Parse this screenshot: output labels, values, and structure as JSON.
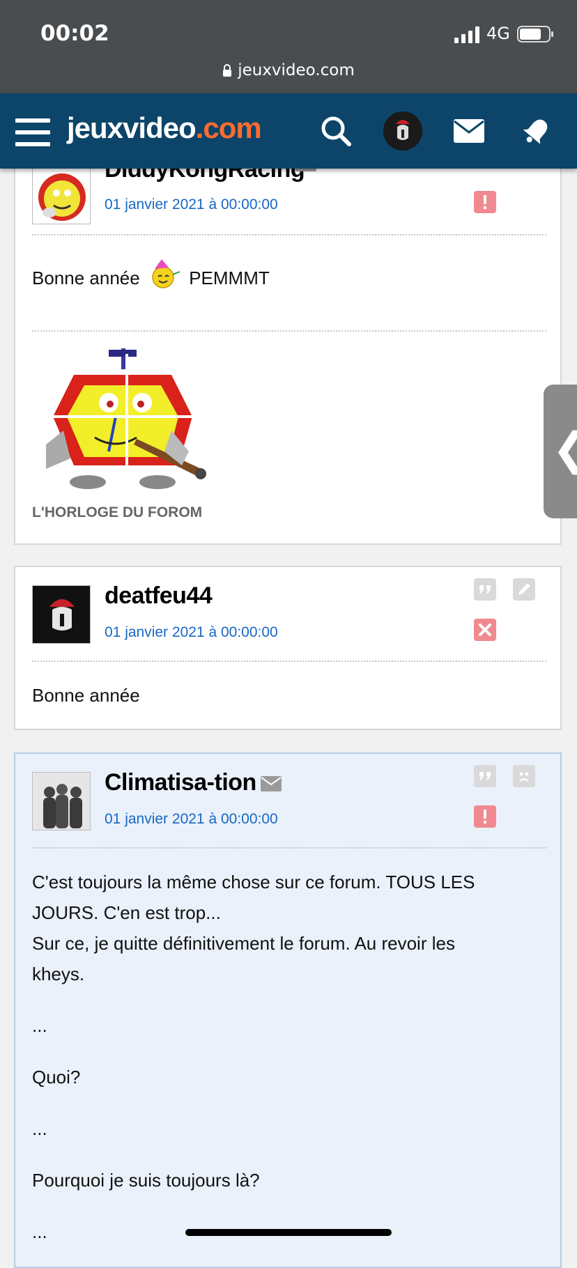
{
  "status_bar": {
    "time": "00:02",
    "network": "4G",
    "url": "jeuxvideo.com"
  },
  "header": {
    "logo_main": "jeuxvideo",
    "logo_suffix": ".com"
  },
  "posts": [
    {
      "author": "DiddyKongRacing",
      "date": "01 janvier 2021 à 00:00:00",
      "message_before_smiley": "Bonne année",
      "message_after_smiley": "PEMMMT",
      "signature_label": "L'HORLOGE DU FOROM"
    },
    {
      "author": "deatfeu44",
      "date": "01 janvier 2021 à 00:00:00",
      "message": "Bonne année"
    },
    {
      "author": "Climatisa-tion",
      "date": "01 janvier 2021 à 00:00:00",
      "lines": [
        "C'est toujours la même chose sur ce forum. TOUS LES",
        "JOURS. C'en est trop...",
        "Sur ce, je quitte définitivement le forum. Au revoir les",
        "kheys.",
        "...",
        "Quoi?",
        "...",
        "Pourquoi je suis toujours là?",
        "..."
      ]
    }
  ],
  "side_tab": {
    "glyph": "❮"
  },
  "colors": {
    "header_bg": "#0c4569",
    "logo_accent": "#ff6b2e",
    "date_blue": "#1767c4",
    "alert_red": "#f08a90"
  }
}
